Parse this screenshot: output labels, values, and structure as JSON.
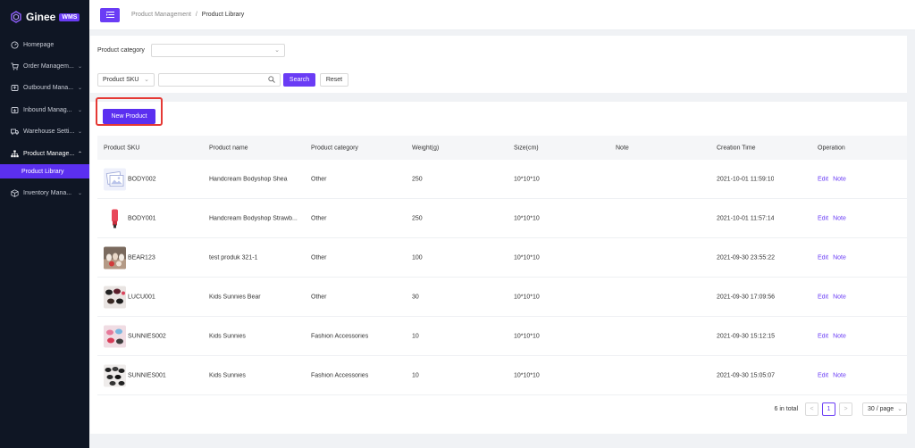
{
  "brand": {
    "name": "Ginee",
    "badge": "WMS"
  },
  "sidebar": {
    "items": [
      {
        "label": "Homepage",
        "icon": "dashboard-icon",
        "chevron": false
      },
      {
        "label": "Order Managem...",
        "icon": "cart-icon",
        "chevron": true
      },
      {
        "label": "Outbound Mana...",
        "icon": "outbound-icon",
        "chevron": true
      },
      {
        "label": "Inbound Manag...",
        "icon": "inbound-icon",
        "chevron": true
      },
      {
        "label": "Warehouse Setti...",
        "icon": "truck-icon",
        "chevron": true
      },
      {
        "label": "Product Manage...",
        "icon": "sitemap-icon",
        "chevron": true,
        "expanded": true
      },
      {
        "label": "Inventory Mana...",
        "icon": "box-icon",
        "chevron": true
      }
    ],
    "submenu_active": "Product Library"
  },
  "header": {
    "breadcrumb_parent": "Product Management",
    "breadcrumb_sep": "/",
    "breadcrumb_current": "Product Library"
  },
  "filter": {
    "category_label": "Product category",
    "category_value": "",
    "sku_select_value": "Product SKU",
    "search_value": "",
    "search_label": "Search",
    "reset_label": "Reset"
  },
  "main": {
    "new_product_label": "New Product"
  },
  "table": {
    "columns": [
      "Product SKU",
      "Product name",
      "Product category",
      "Weight(g)",
      "Size(cm)",
      "Note",
      "Creation Time",
      "Operation"
    ],
    "rows": [
      {
        "sku": "BODY002",
        "name": "Handcream Bodyshop Shea",
        "category": "Other",
        "weight": "250",
        "size": "10*10*10",
        "note": "",
        "time": "2021-10-01 11:59:10",
        "edit": "Edit",
        "note_link": "Note",
        "thumb": "placeholder"
      },
      {
        "sku": "BODY001",
        "name": "Handcream Bodyshop Strawb...",
        "category": "Other",
        "weight": "250",
        "size": "10*10*10",
        "note": "",
        "time": "2021-10-01 11:57:14",
        "edit": "Edit",
        "note_link": "Note",
        "thumb": "tube"
      },
      {
        "sku": "BEAR123",
        "name": "test produk 321-1",
        "category": "Other",
        "weight": "100",
        "size": "10*10*10",
        "note": "",
        "time": "2021-09-30 23:55:22",
        "edit": "Edit",
        "note_link": "Note",
        "thumb": "photo"
      },
      {
        "sku": "LUCU001",
        "name": "Kids Sunnies Bear",
        "category": "Other",
        "weight": "30",
        "size": "10*10*10",
        "note": "",
        "time": "2021-09-30 17:09:56",
        "edit": "Edit",
        "note_link": "Note",
        "thumb": "glasses"
      },
      {
        "sku": "SUNNIES002",
        "name": "Kids Sunnies",
        "category": "Fashion Accessories",
        "weight": "10",
        "size": "10*10*10",
        "note": "",
        "time": "2021-09-30 15:12:15",
        "edit": "Edit",
        "note_link": "Note",
        "thumb": "pink"
      },
      {
        "sku": "SUNNIES001",
        "name": "Kids Sunnies",
        "category": "Fashion Accessories",
        "weight": "10",
        "size": "10*10*10",
        "note": "",
        "time": "2021-09-30 15:05:07",
        "edit": "Edit",
        "note_link": "Note",
        "thumb": "glasses2"
      }
    ]
  },
  "pagination": {
    "total": "6 in total",
    "prev": "<",
    "current": "1",
    "next": ">",
    "page_size": "30 / page"
  },
  "colors": {
    "accent": "#6a3cf5",
    "sidebar": "#0f1624",
    "highlight": "#e53935"
  }
}
